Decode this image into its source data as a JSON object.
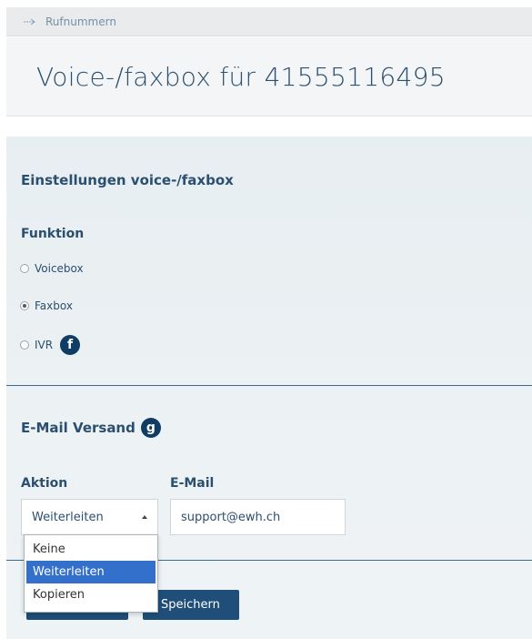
{
  "breadcrumb": {
    "label": "Rufnummern"
  },
  "page": {
    "title": "Voice-/faxbox für 41555116495"
  },
  "settings": {
    "section_title": "Einstellungen voice-/faxbox",
    "function_label": "Funktion",
    "options": [
      {
        "label": "Voicebox",
        "checked": false
      },
      {
        "label": "Faxbox",
        "checked": true
      },
      {
        "label": "IVR",
        "checked": false
      }
    ],
    "ivr_badge": "f"
  },
  "email": {
    "section_title": "E-Mail Versand",
    "badge": "g",
    "action_label": "Aktion",
    "email_label": "E-Mail",
    "action_value": "Weiterleiten",
    "email_value": "support@ewh.ch",
    "dropdown_options": [
      "Keine",
      "Weiterleiten",
      "Kopieren"
    ],
    "dropdown_selected": "Weiterleiten"
  },
  "buttons": {
    "save_label": "Speichern"
  },
  "colors": {
    "primary": "#1f4e78",
    "accent": "#3370cc",
    "badge": "#0f3d63"
  }
}
